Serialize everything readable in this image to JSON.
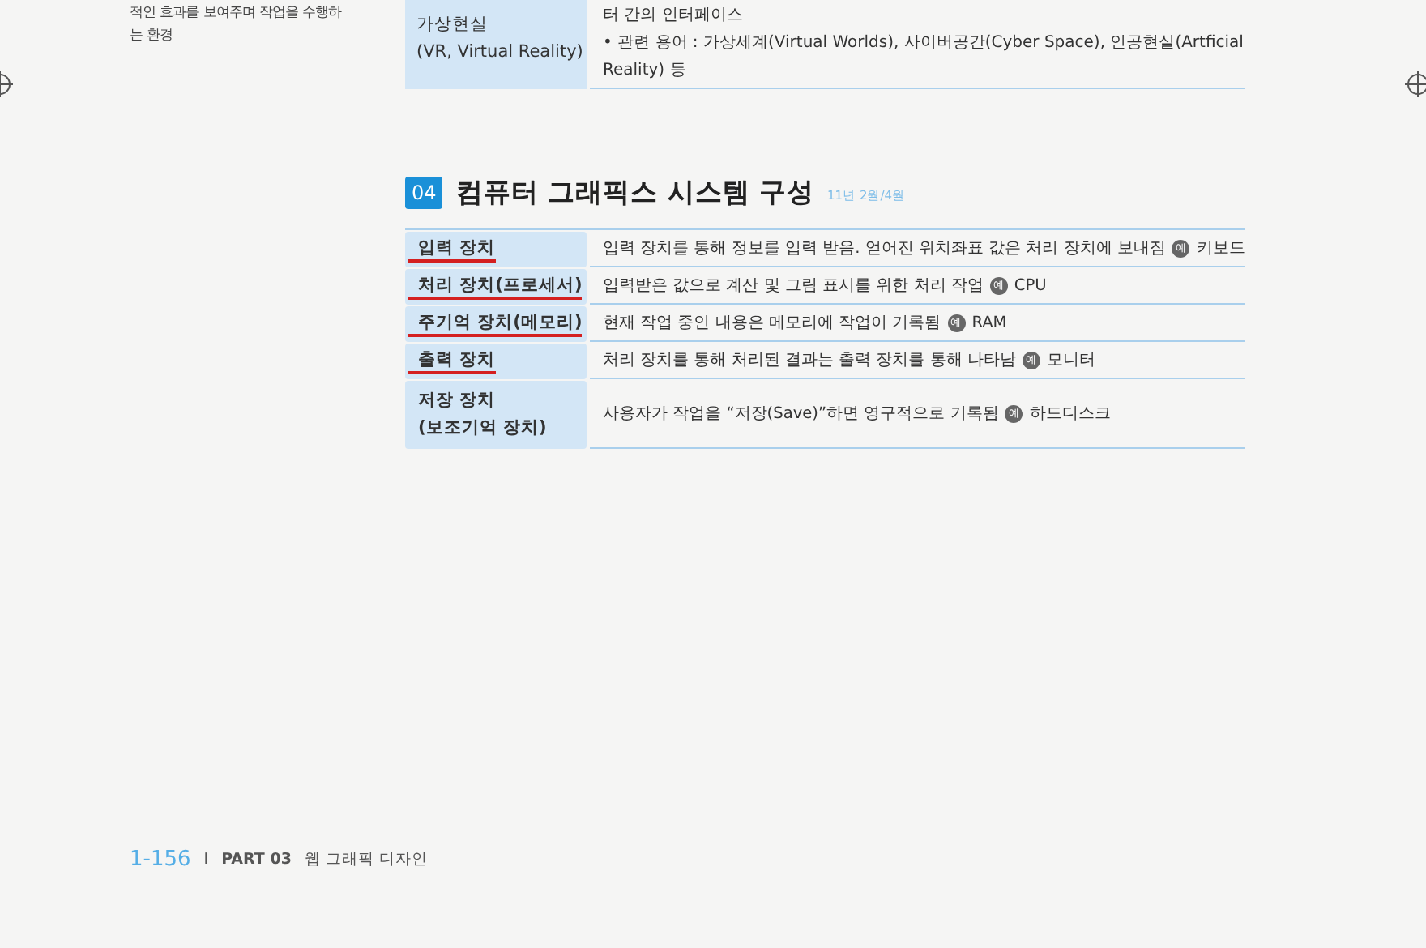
{
  "top_section": {
    "side_note": [
      "적인 효과를 보여주며 작업을 수행하",
      "는 환경"
    ],
    "term": [
      "가상현실",
      "(VR, Virtual Reality)"
    ],
    "description": [
      "터 간의 인터페이스",
      "• 관련 용어 : 가상세계(Virtual Worlds), 사이버공간(Cyber Space), 인공현실(Artficial Reality) 등"
    ]
  },
  "section": {
    "number": "04",
    "title": "컴퓨터 그래픽스 시스템 구성",
    "exam_dates": "11년 2월/4월"
  },
  "rows": [
    {
      "term": [
        "입력 장치"
      ],
      "underlined": true,
      "description": "입력 장치를 통해 정보를 입력 받음. 얻어진 위치좌표 값은 처리 장치에 보내짐",
      "example_mark": "예",
      "example": "키보드"
    },
    {
      "term": [
        "처리 장치(프로세서)"
      ],
      "underlined": true,
      "description": "입력받은 값으로 계산 및 그림 표시를 위한 처리 작업",
      "example_mark": "예",
      "example": "CPU"
    },
    {
      "term": [
        "주기억 장치(메모리)"
      ],
      "underlined": true,
      "description": "현재 작업 중인 내용은 메모리에 작업이 기록됨",
      "example_mark": "예",
      "example": "RAM"
    },
    {
      "term": [
        "출력 장치"
      ],
      "underlined": true,
      "description": "처리 장치를 통해 처리된 결과는 출력 장치를 통해 나타남",
      "example_mark": "예",
      "example": "모니터"
    },
    {
      "term": [
        "저장 장치",
        "(보조기억 장치)"
      ],
      "underlined": false,
      "description": "사용자가 작업을 “저장(Save)”하면 영구적으로 기록됨",
      "example_mark": "예",
      "example": "하드디스크"
    }
  ],
  "footer": {
    "page_number": "1-156",
    "separator": "I",
    "part": "PART 03",
    "chapter": "웹 그래픽 디자인"
  }
}
